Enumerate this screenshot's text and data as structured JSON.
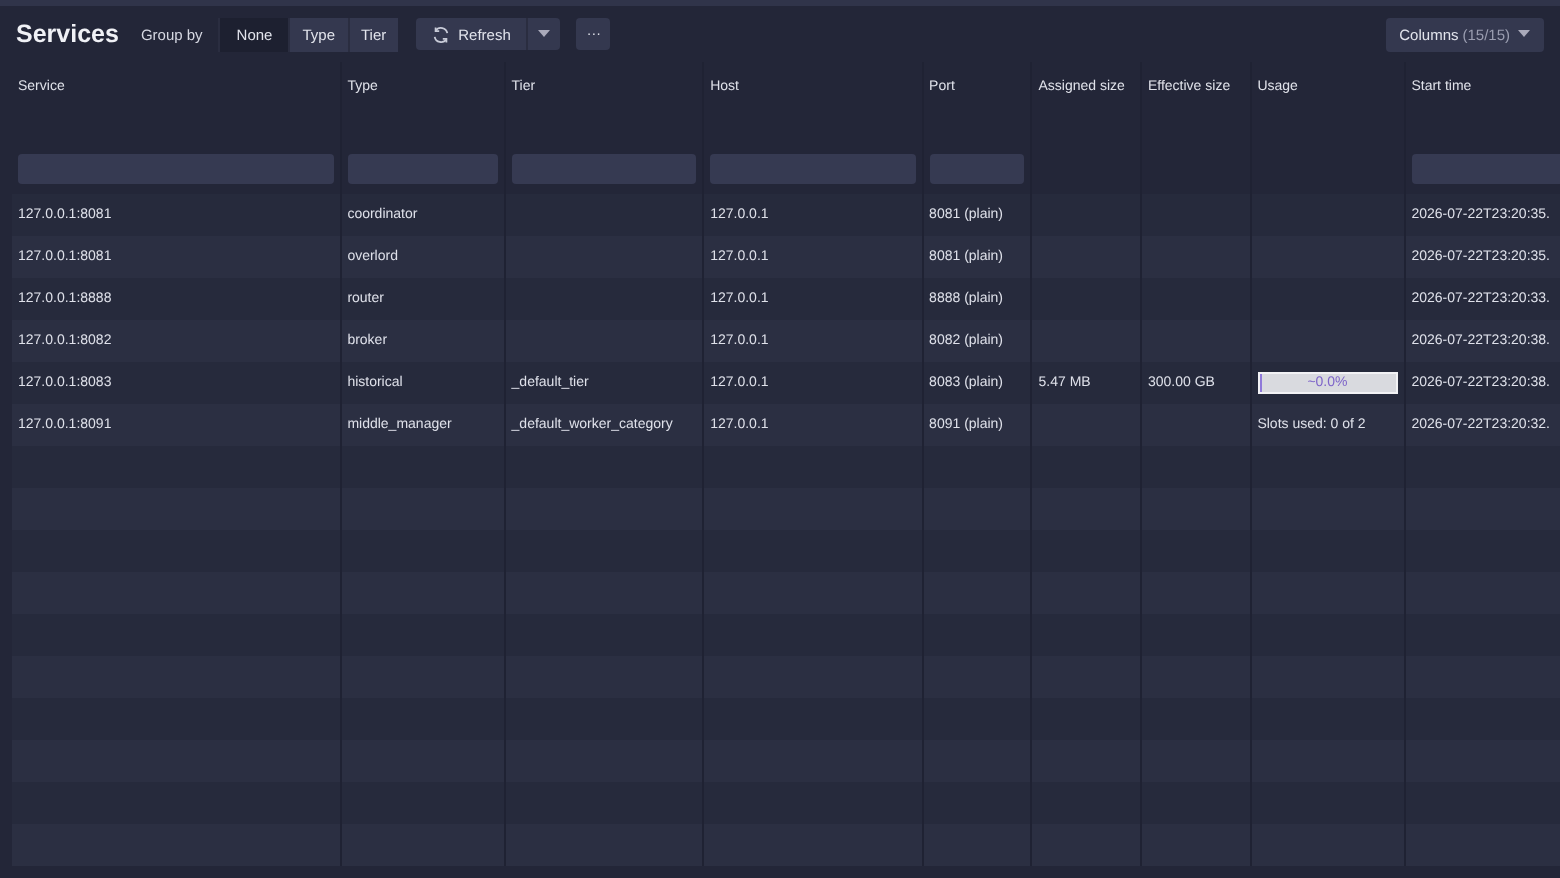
{
  "title": "Services",
  "group_by": {
    "label": "Group by",
    "options": [
      {
        "label": "None",
        "selected": true
      },
      {
        "label": "Type",
        "selected": false
      },
      {
        "label": "Tier",
        "selected": false
      }
    ]
  },
  "refresh_button": {
    "label": "Refresh"
  },
  "more_button": {
    "label": "···"
  },
  "columns_button": {
    "label": "Columns",
    "count": "(15/15)"
  },
  "table": {
    "columns": [
      {
        "label": "Service",
        "filter": true
      },
      {
        "label": "Type",
        "filter": true
      },
      {
        "label": "Tier",
        "filter": true
      },
      {
        "label": "Host",
        "filter": true
      },
      {
        "label": "Port",
        "filter": true
      },
      {
        "label": "Assigned size",
        "filter": false
      },
      {
        "label": "Effective size",
        "filter": false
      },
      {
        "label": "Usage",
        "filter": false
      },
      {
        "label": "Start time",
        "filter": true
      }
    ],
    "rows": [
      {
        "cells": [
          "127.0.0.1:8081",
          "coordinator",
          "",
          "127.0.0.1",
          "8081 (plain)",
          "",
          "",
          "",
          "2026-07-22T23:20:35."
        ]
      },
      {
        "cells": [
          "127.0.0.1:8081",
          "overlord",
          "",
          "127.0.0.1",
          "8081 (plain)",
          "",
          "",
          "",
          "2026-07-22T23:20:35."
        ]
      },
      {
        "cells": [
          "127.0.0.1:8888",
          "router",
          "",
          "127.0.0.1",
          "8888 (plain)",
          "",
          "",
          "",
          "2026-07-22T23:20:33."
        ]
      },
      {
        "cells": [
          "127.0.0.1:8082",
          "broker",
          "",
          "127.0.0.1",
          "8082 (plain)",
          "",
          "",
          "",
          "2026-07-22T23:20:38."
        ]
      },
      {
        "cells": [
          "127.0.0.1:8083",
          "historical",
          "_default_tier",
          "127.0.0.1",
          "8083 (plain)",
          "5.47 MB",
          "300.00 GB",
          "",
          "2026-07-22T23:20:38."
        ],
        "usage": {
          "kind": "bar",
          "level": 0.0,
          "text": "~0.0%"
        }
      },
      {
        "cells": [
          "127.0.0.1:8091",
          "middle_manager",
          "_default_worker_category",
          "127.0.0.1",
          "8091 (plain)",
          "",
          "",
          "",
          "2026-07-22T23:20:32."
        ],
        "usage": {
          "kind": "text",
          "text": "Slots used: 0 of 2"
        }
      }
    ]
  }
}
